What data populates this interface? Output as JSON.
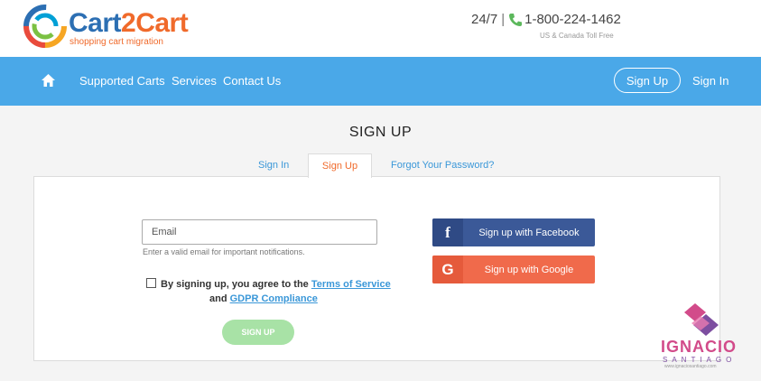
{
  "header": {
    "logo": {
      "word_part1": "Cart",
      "word_part2": "2",
      "word_part3": "Cart",
      "tagline": "shopping cart migration"
    },
    "support": {
      "hours": "24/7",
      "separator": "|",
      "phone": "1-800-224-1462",
      "note": "US & Canada Toll Free"
    }
  },
  "nav": {
    "items": [
      "Supported Carts",
      "Services",
      "Contact Us"
    ],
    "signup": "Sign Up",
    "signin": "Sign In"
  },
  "page": {
    "title": "SIGN UP",
    "tabs": [
      "Sign In",
      "Sign Up",
      "Forgot Your Password?"
    ],
    "active_tab": "Sign Up"
  },
  "form": {
    "email_placeholder": "Email",
    "email_value": "",
    "email_hint": "Enter a valid email for important notifications.",
    "agree_prefix": "By signing up, you agree to the",
    "terms_link": "Terms of Service",
    "agree_and": "and",
    "gdpr_link": "GDPR Compliance",
    "submit": "SIGN UP",
    "agree_checked": false
  },
  "social": {
    "facebook": {
      "icon": "f",
      "label": "Sign up with Facebook"
    },
    "google": {
      "icon": "G",
      "label": "Sign up with Google"
    }
  },
  "watermark": {
    "name": "IGNACIO",
    "sub": "SANTIAGO",
    "url": "www.ignaciosantiago.com"
  },
  "colors": {
    "nav_bg": "#4aa8e8",
    "link": "#3a97d8",
    "accent_orange": "#f06a2b",
    "facebook": "#3b5998",
    "google": "#f06a4b",
    "submit_disabled": "#a8e2a6"
  }
}
